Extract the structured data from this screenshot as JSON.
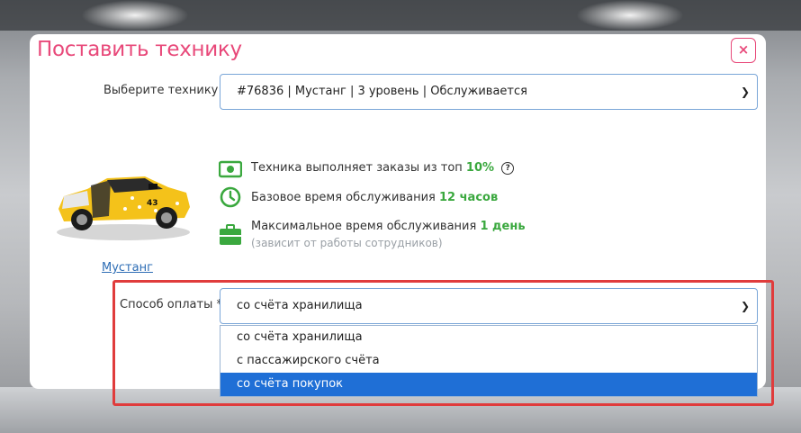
{
  "modal": {
    "title": "Поставить технику",
    "close_label": "×"
  },
  "equipment_field": {
    "label": "Выберите технику *",
    "selected": "#76836 | Мустанг | 3 уровень | Обслуживается"
  },
  "features": [
    {
      "icon": "money-icon",
      "text": "Техника выполняет заказы из топ",
      "highlight": "10%"
    },
    {
      "icon": "clock-icon",
      "text": "Базовое время обслуживания",
      "highlight": "12 часов"
    },
    {
      "icon": "briefcase-icon",
      "text": "Максимальное время обслуживания",
      "highlight": "1 день",
      "note": "(зависит от работы сотрудников)"
    }
  ],
  "car": {
    "name": "Мустанг"
  },
  "payment_field": {
    "label": "Способ оплаты *",
    "selected": "со счёта хранилища",
    "options": [
      "со счёта хранилища",
      "с пассажирского счёта",
      "со счёта покупок"
    ],
    "highlighted_option": "со счёта покупок"
  },
  "colors": {
    "accent": "#e8497a",
    "highlight_green": "#3aa83e",
    "select_blue": "#1f6fd6",
    "annotation_red": "#e03c3c"
  }
}
